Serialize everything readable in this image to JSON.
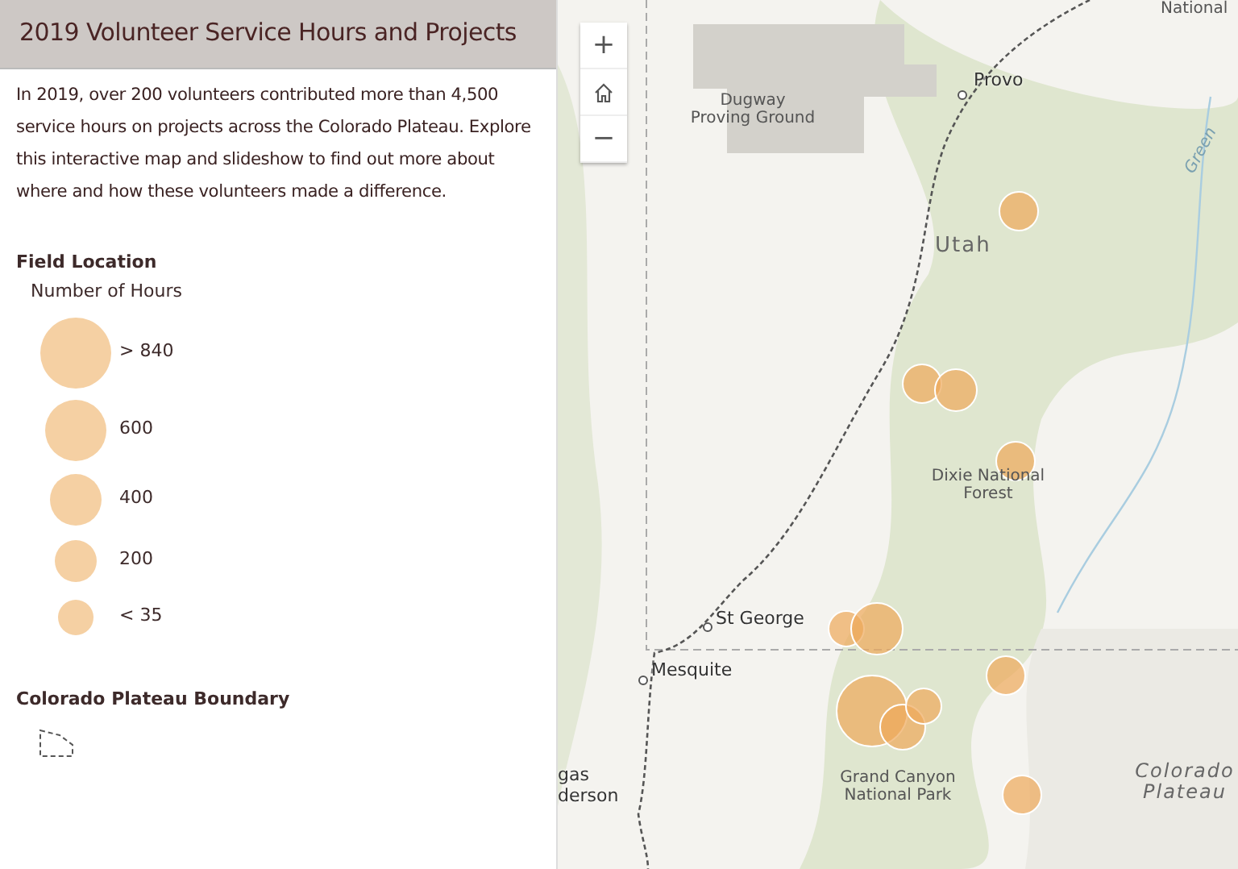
{
  "title": "2019 Volunteer Service Hours and Projects",
  "description": "In 2019, over 200 volunteers contributed more than 4,500 service hours on projects across the Colorado Plateau. Explore this interactive map and slideshow to find out more about where and how these volunteers made a difference.",
  "legend": [
    {
      "kind": "circles",
      "title": "Field Location",
      "subtitle": "Number of Hours",
      "classes": [
        {
          "label": "> 840"
        },
        {
          "label": "600"
        },
        {
          "label": "400"
        },
        {
          "label": "200"
        },
        {
          "label": "< 35"
        }
      ]
    },
    {
      "kind": "boundary",
      "title": "Colorado Plateau Boundary"
    }
  ],
  "map": {
    "controls": [
      {
        "kind": "text",
        "label": "+"
      },
      {
        "kind": "home"
      },
      {
        "kind": "text",
        "label": "−"
      }
    ],
    "labels": [
      {
        "kind": "small",
        "text": "National"
      },
      {
        "kind": "city",
        "text": "Provo"
      },
      {
        "kind": "area",
        "text": "Dugway Proving Ground"
      },
      {
        "kind": "state",
        "text": "Utah"
      },
      {
        "kind": "river",
        "text": "Green"
      },
      {
        "kind": "area",
        "text": "Dixie National Forest"
      },
      {
        "kind": "city",
        "text": "St George"
      },
      {
        "kind": "city",
        "text": "Mesquite"
      },
      {
        "kind": "city",
        "text": "gas"
      },
      {
        "kind": "city",
        "text": "derson"
      },
      {
        "kind": "area",
        "text": "Grand Canyon National Park"
      },
      {
        "kind": "region",
        "text": "Colorado Plateau"
      }
    ]
  }
}
